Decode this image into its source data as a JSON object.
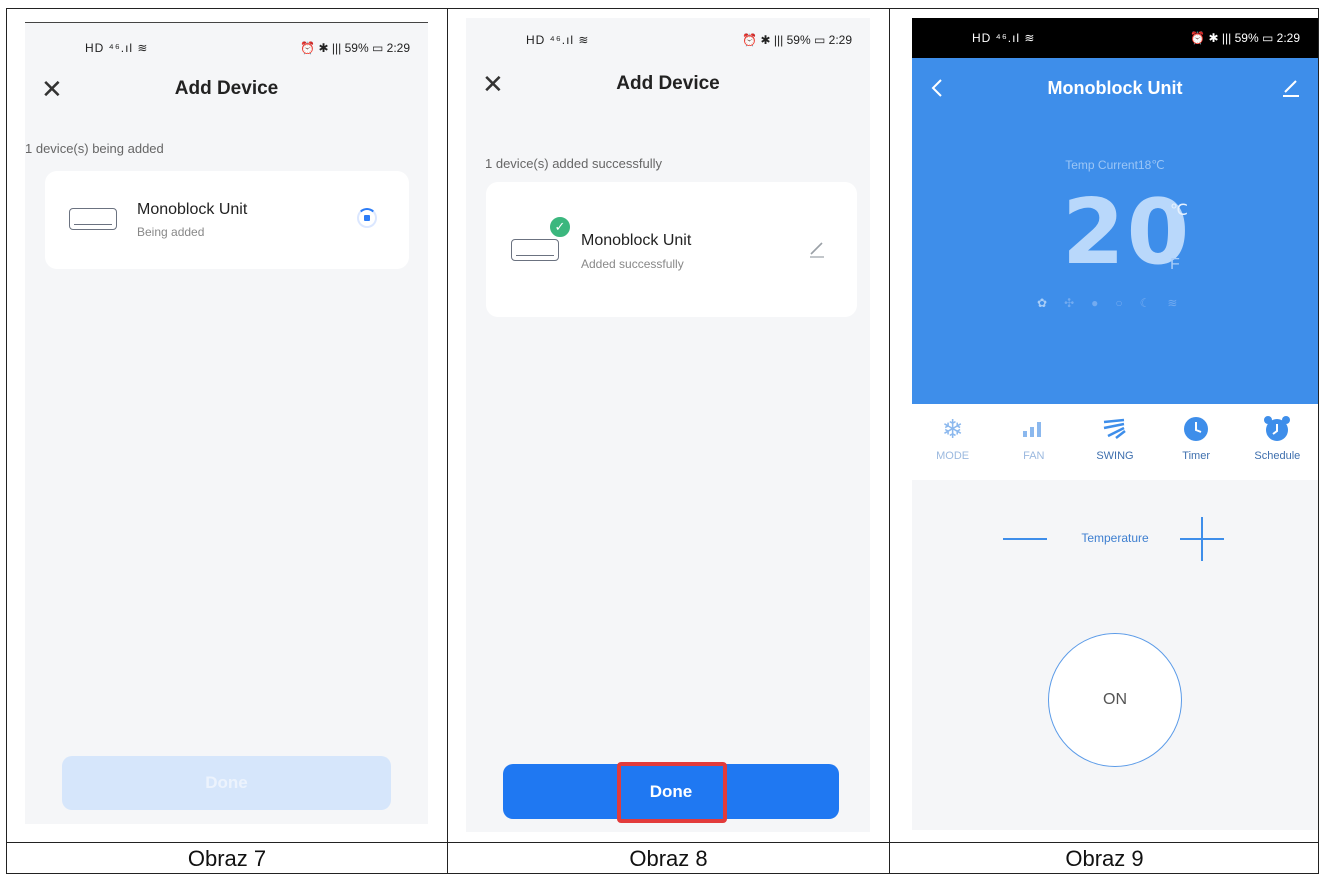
{
  "captions": [
    "Obraz 7",
    "Obraz 8",
    "Obraz 9"
  ],
  "status_bar": {
    "left": "HD ⁴⁶.ıl ≋",
    "right": "⏰ ✱ ||| 59% ▭ 2:29"
  },
  "screen1": {
    "title": "Add Device",
    "section_label": "1 device(s) being added",
    "device_name": "Monoblock Unit",
    "device_status": "Being added",
    "done_label": "Done"
  },
  "screen2": {
    "title": "Add Device",
    "section_label": "1 device(s) added successfully",
    "device_name": "Monoblock Unit",
    "device_status": "Added successfully",
    "done_label": "Done"
  },
  "screen3": {
    "title": "Monoblock Unit",
    "temp_current": "Temp Current18℃",
    "temp_value": "20",
    "unit_c": "℃",
    "unit_f": "F",
    "tools": [
      {
        "label": "MODE",
        "icon": "snowflake-icon"
      },
      {
        "label": "FAN",
        "icon": "fan-speed-icon"
      },
      {
        "label": "SWING",
        "icon": "swing-icon"
      },
      {
        "label": "Timer",
        "icon": "clock-icon"
      },
      {
        "label": "Schedule",
        "icon": "alarm-clock-icon"
      }
    ],
    "temperature_label": "Temperature",
    "power_label": "ON"
  },
  "colors": {
    "accent": "#2c7cf6",
    "panel_blue": "#3e8eea",
    "success": "#3bb77e",
    "highlight": "#e23b3b",
    "disabled_button": "#d6e6fb"
  }
}
